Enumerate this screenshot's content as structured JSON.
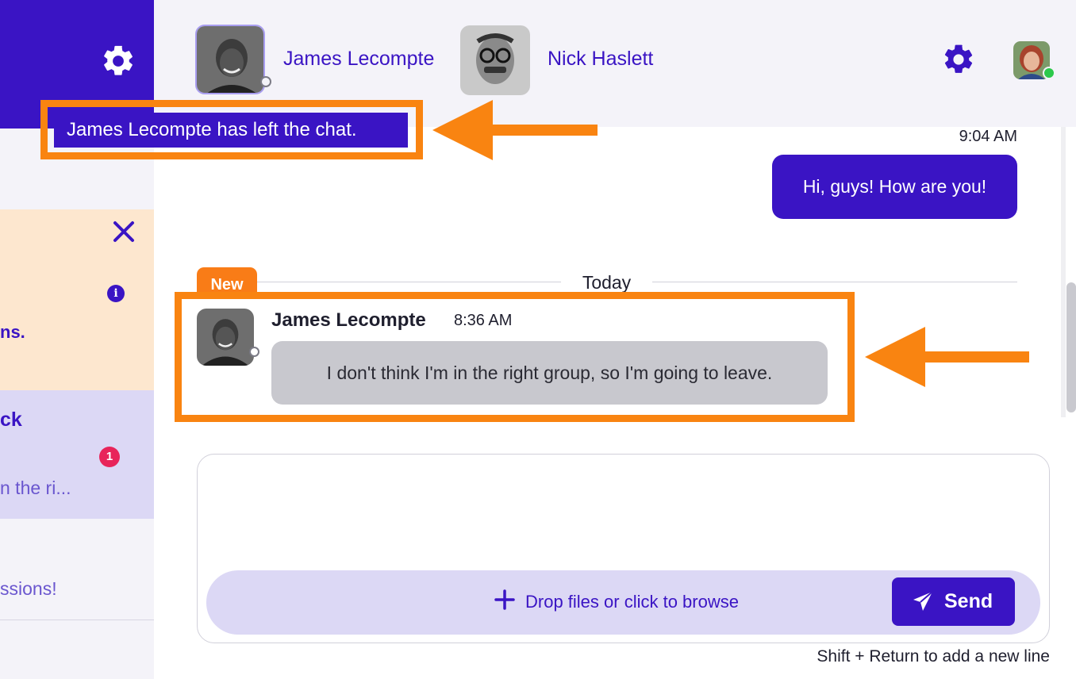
{
  "colors": {
    "brand": "#3a14c4",
    "header_bg": "#f4f3f9",
    "notice_bg": "#fde7cf",
    "active_chat_bg": "#dcd8f5",
    "new_tag": "#f97c17",
    "annotation": "#f98411",
    "unread_badge": "#e8245a",
    "online": "#2cc94b"
  },
  "sidebar": {
    "settings_icon": "gear-icon",
    "notice": {
      "close_icon": "close-icon",
      "info_icon": "info-icon",
      "info_glyph": "i",
      "text_fragment": "ns."
    },
    "active_chat": {
      "name_fragment": "ck",
      "unread_count": "1",
      "preview_fragment": "n the ri..."
    },
    "second_chat": {
      "preview_fragment": "ssions!"
    }
  },
  "header": {
    "participants": [
      {
        "name": "James Lecompte",
        "status": "offline"
      },
      {
        "name": "Nick Haslett"
      }
    ],
    "settings_icon": "gear-icon",
    "current_user_status": "online"
  },
  "toast": {
    "text": "James Lecompte has left the chat."
  },
  "messages": {
    "outgoing": {
      "time": "9:04 AM",
      "text": "Hi, guys! How are you!"
    },
    "new_label": "New",
    "date_separator": "Today",
    "incoming": {
      "author": "James Lecompte",
      "time": "8:36 AM",
      "text": "I don't think I'm in the right group, so I'm going to leave."
    }
  },
  "composer": {
    "placeholder": "",
    "drop_text": "Drop files or click to browse",
    "drop_icon": "plus-icon",
    "send_label": "Send",
    "send_icon": "paper-plane-icon",
    "hint": "Shift + Return to add a new line"
  }
}
